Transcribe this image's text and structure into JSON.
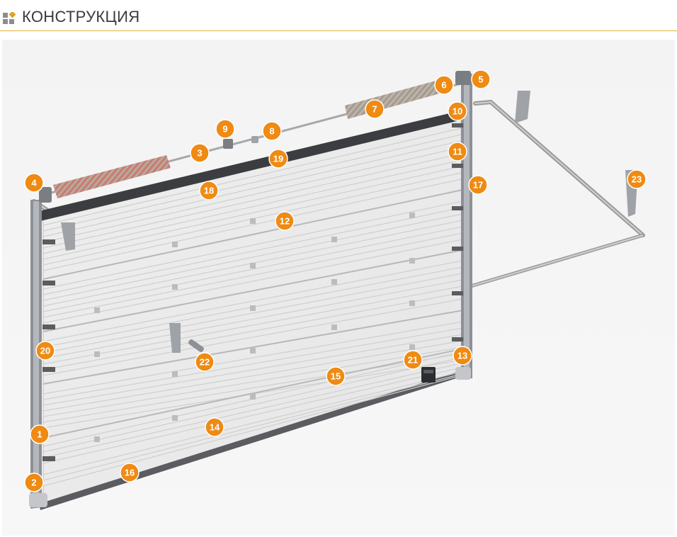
{
  "header": {
    "title": "КОНСТРУКЦИЯ",
    "icon": "blocks-icon",
    "accent_color": "#e2b43a"
  },
  "diagram": {
    "subject": "sectional garage door construction",
    "callout_color": "#ef8a12",
    "callouts": [
      "1",
      "2",
      "3",
      "4",
      "5",
      "6",
      "7",
      "8",
      "9",
      "10",
      "11",
      "12",
      "13",
      "14",
      "15",
      "16",
      "17",
      "18",
      "19",
      "20",
      "21",
      "22",
      "23"
    ]
  }
}
